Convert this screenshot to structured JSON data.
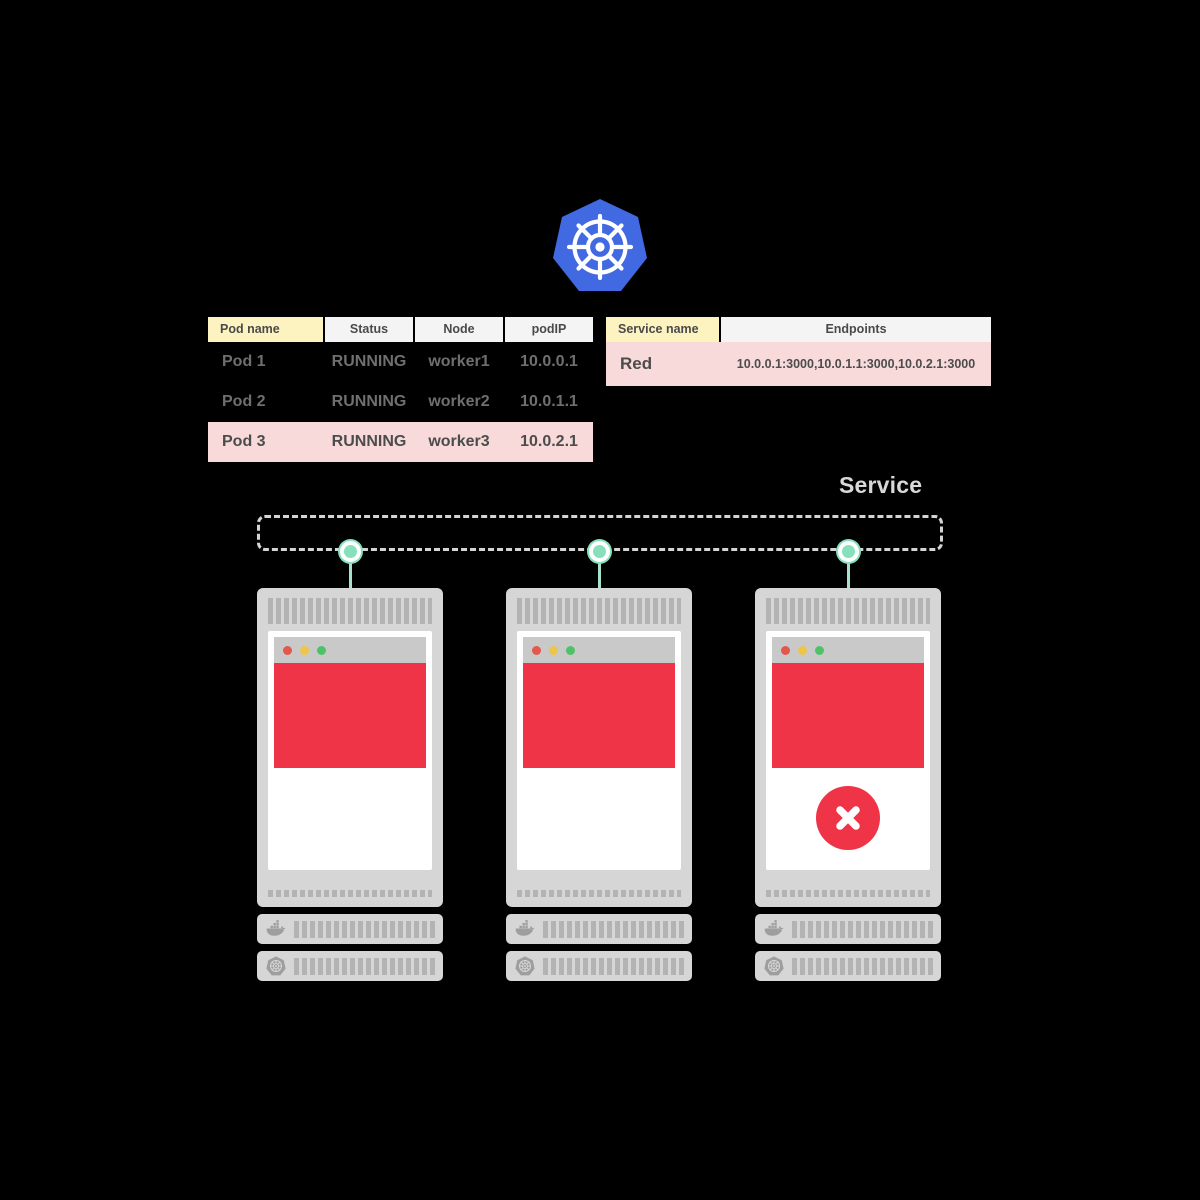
{
  "diagram": {
    "title_logo": "kubernetes-logo",
    "service_label": "Service"
  },
  "pods_table": {
    "headers": [
      "Pod name",
      "Status",
      "Node",
      "podIP"
    ],
    "rows": [
      {
        "pod": "Pod 1",
        "status": "RUNNING",
        "node": "worker1",
        "ip": "10.0.0.1",
        "highlight": false
      },
      {
        "pod": "Pod 2",
        "status": "RUNNING",
        "node": "worker2",
        "ip": "10.0.1.1",
        "highlight": false
      },
      {
        "pod": "Pod 3",
        "status": "RUNNING",
        "node": "worker3",
        "ip": "10.0.2.1",
        "highlight": true
      }
    ]
  },
  "service_table": {
    "headers": [
      "Service name",
      "Endpoints"
    ],
    "rows": [
      {
        "name": "Red",
        "endpoints": "10.0.0.1:3000,10.0.1.1:3000,10.0.2.1:3000"
      }
    ]
  },
  "servers": [
    {
      "id": "server-1",
      "icons": [
        "docker-icon",
        "kubernetes-icon"
      ],
      "has_error": false
    },
    {
      "id": "server-2",
      "icons": [
        "docker-icon",
        "kubernetes-icon"
      ],
      "has_error": false
    },
    {
      "id": "server-3",
      "icons": [
        "docker-icon",
        "kubernetes-icon"
      ],
      "has_error": true
    }
  ],
  "colors": {
    "background": "#000000",
    "kubernetes_blue": "#4169E1",
    "app_red": "#EE3446",
    "highlight_pink": "#F8DADA",
    "header_yellow": "#FCF3C0",
    "header_gray": "#F4F4F5",
    "connector_mint": "#86E0BB",
    "chassis_gray": "#D6D6D6",
    "vent_gray": "#B3B3B3",
    "service_label_gray": "#D8D8D8"
  }
}
